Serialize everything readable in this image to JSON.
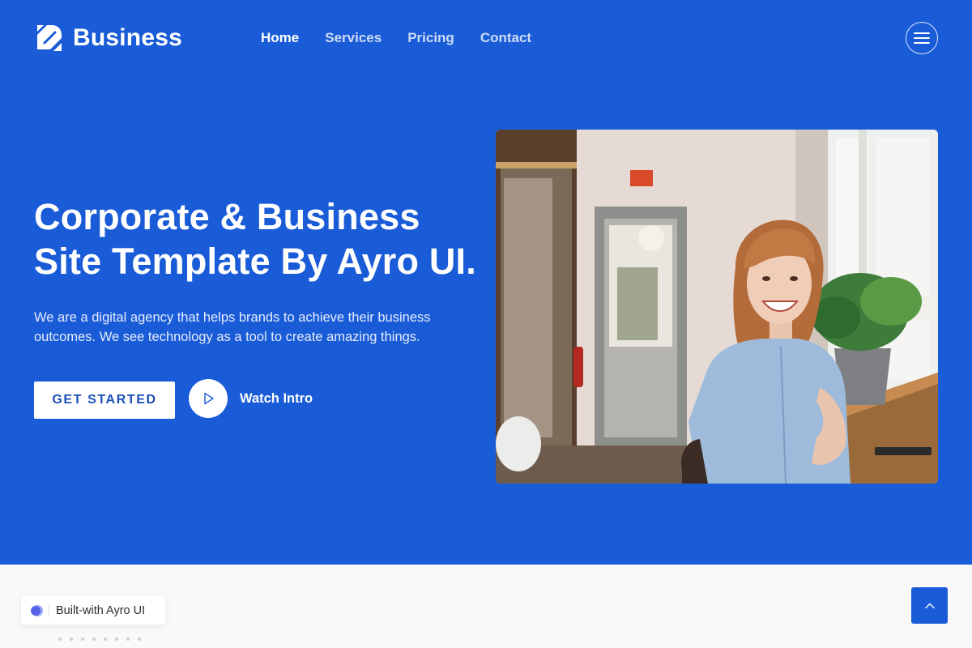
{
  "brand": {
    "name": "Business",
    "icon": "brand-logo-icon"
  },
  "nav": {
    "items": [
      {
        "label": "Home",
        "active": true
      },
      {
        "label": "Services",
        "active": false
      },
      {
        "label": "Pricing",
        "active": false
      },
      {
        "label": "Contact",
        "active": false
      }
    ],
    "menu_icon": "hamburger-icon"
  },
  "hero": {
    "title_line1": "Corporate & Business",
    "title_line2": "Site Template By Ayro UI.",
    "text_line1": "We are a digital agency that helps brands to achieve their business",
    "text_line2": "outcomes. We see technology as a tool to create amazing things.",
    "cta_label": "GET STARTED",
    "watch_label": "Watch Intro",
    "watch_icon": "play-icon",
    "photo_icon": "woman-office-photo"
  },
  "footer": {
    "badge_label": "Built-with Ayro UI",
    "badge_icon": "ayro-logo-icon",
    "back_to_top_icon": "chevron-up-icon"
  },
  "colors": {
    "primary": "#1a5cd8",
    "surface": "#f9f9f9",
    "button_text": "#1a4fb8"
  }
}
